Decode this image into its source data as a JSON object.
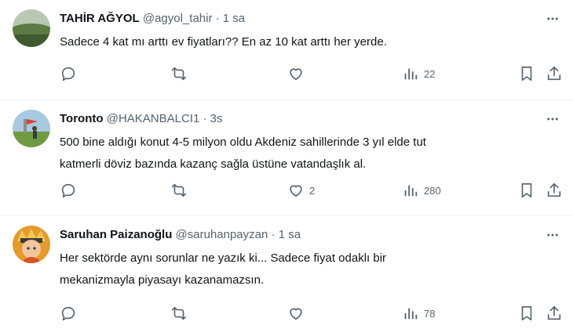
{
  "colors": {
    "text": "#0f1419",
    "secondary": "#536471",
    "divider": "#eff3f4",
    "background": "#ffffff"
  },
  "icons": {
    "more": "more-dots-icon",
    "reply": "reply-icon",
    "retweet": "retweet-icon",
    "like": "like-icon",
    "views": "views-icon",
    "bookmark": "bookmark-icon",
    "share": "share-icon"
  },
  "tweets": [
    {
      "name": "TAHİR AĞYOL",
      "handle": "@agyol_tahir",
      "separator": "·",
      "time": "1 sa",
      "lines": [
        "Sadece 4 kat mı arttı ev fiyatları?? En az 10 kat arttı her yerde."
      ],
      "likes": "",
      "views": "22"
    },
    {
      "name": "Toronto",
      "handle": "@HAKANBALCI1",
      "separator": "·",
      "time": "3s",
      "lines": [
        "500 bine aldığı konut 4-5 milyon oldu Akdeniz sahillerinde 3 yıl elde tut",
        "katmerli döviz bazında kazanç sağla üstüne vatandaşlık al."
      ],
      "likes": "2",
      "views": "280"
    },
    {
      "name": "Saruhan Paizanoğlu",
      "handle": "@saruhanpayzan",
      "separator": "·",
      "time": "1 sa",
      "lines": [
        "Her sektörde aynı sorunlar ne yazık ki... Sadece fiyat odaklı bir",
        "mekanizmayla piyasayı kazanamazsın."
      ],
      "likes": "",
      "views": "78"
    }
  ]
}
